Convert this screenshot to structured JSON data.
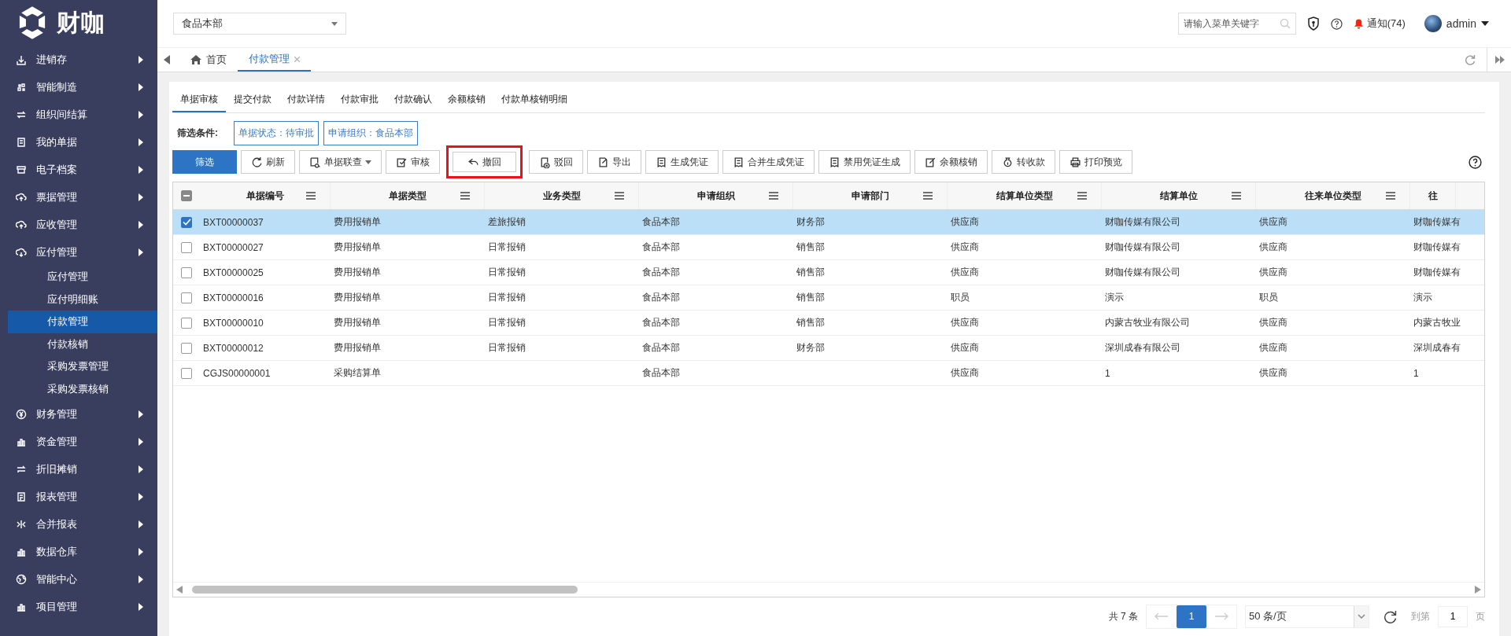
{
  "logo": {
    "text": "财咖"
  },
  "sidebar": {
    "items": [
      {
        "label": "进销存",
        "selected": false
      },
      {
        "label": "智能制造",
        "selected": false
      },
      {
        "label": "组织间结算",
        "selected": false
      },
      {
        "label": "我的单据",
        "selected": false
      },
      {
        "label": "电子档案",
        "selected": false
      },
      {
        "label": "票据管理",
        "selected": false
      },
      {
        "label": "应收管理",
        "selected": false
      },
      {
        "label": "应付管理",
        "selected": false,
        "children": [
          {
            "label": "应付管理",
            "selected": false
          },
          {
            "label": "应付明细账",
            "selected": false
          },
          {
            "label": "付款管理",
            "selected": true
          },
          {
            "label": "付款核销",
            "selected": false
          },
          {
            "label": "采购发票管理",
            "selected": false
          },
          {
            "label": "采购发票核销",
            "selected": false
          }
        ]
      },
      {
        "label": "财务管理",
        "selected": false
      },
      {
        "label": "资金管理",
        "selected": false
      },
      {
        "label": "折旧摊销",
        "selected": false
      },
      {
        "label": "报表管理",
        "selected": false
      },
      {
        "label": "合并报表",
        "selected": false
      },
      {
        "label": "数据仓库",
        "selected": false
      },
      {
        "label": "智能中心",
        "selected": false
      },
      {
        "label": "项目管理",
        "selected": false
      }
    ]
  },
  "header": {
    "org_select": "食品本部",
    "search": {
      "placeholder": "请输入菜单关键字"
    },
    "notifications": "通知(74)",
    "user": "admin"
  },
  "page_tabs": [
    {
      "label": "首页",
      "selected": false,
      "kind": "home"
    },
    {
      "label": "付款管理",
      "selected": true,
      "kind": "closable"
    }
  ],
  "sub_tabs": [
    {
      "label": "单据审核",
      "selected": true
    },
    {
      "label": "提交付款",
      "selected": false
    },
    {
      "label": "付款详情",
      "selected": false
    },
    {
      "label": "付款审批",
      "selected": false
    },
    {
      "label": "付款确认",
      "selected": false
    },
    {
      "label": "余额核销",
      "selected": false
    },
    {
      "label": "付款单核销明细",
      "selected": false
    }
  ],
  "filter": {
    "label": "筛选条件:",
    "tags": [
      "单据状态：待审批",
      "申请组织：食品本部"
    ]
  },
  "toolbar": [
    {
      "label": "筛选",
      "kind": "primary",
      "highlighted": false
    },
    {
      "label": "刷新",
      "kind": "default",
      "highlighted": false
    },
    {
      "label": "单据联查",
      "kind": "dropdown",
      "highlighted": false
    },
    {
      "label": "审核",
      "kind": "default",
      "highlighted": false
    },
    {
      "label": "撤回",
      "kind": "default",
      "highlighted": true
    },
    {
      "label": "驳回",
      "kind": "default",
      "highlighted": false
    },
    {
      "label": "导出",
      "kind": "default",
      "highlighted": false
    },
    {
      "label": "生成凭证",
      "kind": "default",
      "highlighted": false
    },
    {
      "label": "合并生成凭证",
      "kind": "default",
      "highlighted": false
    },
    {
      "label": "禁用凭证生成",
      "kind": "default",
      "highlighted": false
    },
    {
      "label": "余额核销",
      "kind": "default",
      "highlighted": false
    },
    {
      "label": "转收款",
      "kind": "default",
      "highlighted": false
    },
    {
      "label": "打印预览",
      "kind": "default",
      "highlighted": false
    }
  ],
  "table": {
    "indeterminate": true,
    "columns": [
      "单据编号",
      "单据类型",
      "业务类型",
      "申请组织",
      "申请部门",
      "结算单位类型",
      "结算单位",
      "往来单位类型",
      "往"
    ],
    "rows": [
      {
        "checked": true,
        "selected": true,
        "cells": [
          "BXT00000037",
          "费用报销单",
          "差旅报销",
          "食品本部",
          "财务部",
          "供应商",
          "财咖传媒有限公司",
          "供应商",
          "财咖传媒有"
        ]
      },
      {
        "checked": false,
        "selected": false,
        "cells": [
          "BXT00000027",
          "费用报销单",
          "日常报销",
          "食品本部",
          "销售部",
          "供应商",
          "财咖传媒有限公司",
          "供应商",
          "财咖传媒有"
        ]
      },
      {
        "checked": false,
        "selected": false,
        "cells": [
          "BXT00000025",
          "费用报销单",
          "日常报销",
          "食品本部",
          "销售部",
          "供应商",
          "财咖传媒有限公司",
          "供应商",
          "财咖传媒有"
        ]
      },
      {
        "checked": false,
        "selected": false,
        "cells": [
          "BXT00000016",
          "费用报销单",
          "日常报销",
          "食品本部",
          "销售部",
          "职员",
          "演示",
          "职员",
          "演示"
        ]
      },
      {
        "checked": false,
        "selected": false,
        "cells": [
          "BXT00000010",
          "费用报销单",
          "日常报销",
          "食品本部",
          "销售部",
          "供应商",
          "内蒙古牧业有限公司",
          "供应商",
          "内蒙古牧业"
        ]
      },
      {
        "checked": false,
        "selected": false,
        "cells": [
          "BXT00000012",
          "费用报销单",
          "日常报销",
          "食品本部",
          "财务部",
          "供应商",
          "深圳成春有限公司",
          "供应商",
          "深圳成春有"
        ]
      },
      {
        "checked": false,
        "selected": false,
        "cells": [
          "CGJS00000001",
          "采购结算单",
          "",
          "食品本部",
          "",
          "供应商",
          "1",
          "供应商",
          "1"
        ]
      }
    ]
  },
  "pagination": {
    "total": "共 7 条",
    "current_page": "1",
    "page_size": "50 条/页",
    "goto_label": "到第",
    "goto_value": "1",
    "page_unit": "页"
  }
}
